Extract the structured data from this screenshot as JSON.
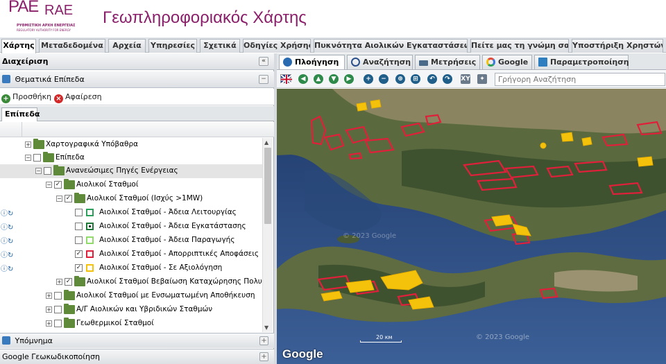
{
  "brand": {
    "logo_main": "PAE",
    "logo_alt": "RAE",
    "logo_sub1": "ΡΥΘΜΙΣΤΙΚΗ ΑΡΧΗ ΕΝΕΡΓΕΙΑΣ",
    "logo_sub2": "REGULATORY AUTHORITY FOR ENERGY",
    "title": "Γεωπληροφοριακός Χάρτης",
    "color": "#8a1f6a"
  },
  "top_tabs": [
    {
      "label": "Χάρτης",
      "active": true
    },
    {
      "label": "Μεταδεδομένα",
      "active": false
    },
    {
      "label": "Αρχεία",
      "active": false
    },
    {
      "label": "Υπηρεσίες",
      "active": false
    },
    {
      "label": "Σχετικά",
      "active": false
    },
    {
      "label": "Οδηγίες Χρήσης",
      "active": false
    },
    {
      "label": "Πυκνότητα Αιολικών Εγκαταστάσεων",
      "active": false
    },
    {
      "label": "Πείτε μας τη γνώμη σας",
      "active": false
    },
    {
      "label": "Υποστήριξη Χρηστών",
      "active": false
    }
  ],
  "left_panel": {
    "title": "Διαχείριση",
    "collapse_icon": "double-chevron-left-icon",
    "thematic_title": "Θεματικά Επίπεδα",
    "add_label": "Προσθήκη",
    "remove_label": "Αφαίρεση",
    "inner_tab": "Επίπεδα",
    "legend_title": "Υπόμνημα",
    "geocode_title": "Google Γεωκωδικοποίηση"
  },
  "tree": [
    {
      "label": "Χαρτογραφικά Υπόβαθρα",
      "checked": false,
      "expander": "+",
      "legend": null
    },
    {
      "label": "Επίπεδα",
      "checked": false,
      "expander": "−",
      "legend": null
    },
    {
      "label": "Ανανεώσιμες Πηγές Ενέργειας",
      "checked": false,
      "expander": "−",
      "legend": null,
      "highlight": true
    },
    {
      "label": "Αιολικοί Σταθμοί",
      "checked": true,
      "expander": "−",
      "legend": null
    },
    {
      "label": "Αιολικοί Σταθμοί (Ισχύς >1MW)",
      "checked": true,
      "expander": "−",
      "legend": null
    },
    {
      "label": "Αιολικοί Σταθμοί - Άδεια Λειτουργίας",
      "checked": false,
      "expander": null,
      "legend": "#2aa05a",
      "info": true
    },
    {
      "label": "Αιολικοί Σταθμοί - Άδεια Εγκατάστασης",
      "checked": false,
      "expander": null,
      "legend": "#1f7a3a",
      "info": true
    },
    {
      "label": "Αιολικοί Σταθμοί - Άδεια Παραγωγής",
      "checked": false,
      "expander": null,
      "legend": "#8fdc6a",
      "info": true
    },
    {
      "label": "Αιολικοί Σταθμοί - Απορριπτικές Αποφάσεις",
      "checked": true,
      "expander": null,
      "legend": "#e0203a",
      "info": true
    },
    {
      "label": "Αιολικοί Σταθμοί - Σε Αξιολόγηση",
      "checked": true,
      "expander": null,
      "legend": "#f4c20a",
      "info": true
    },
    {
      "label": "Αιολικοί Σταθμοί Βεβαίωση Καταχώρησης Πολυγώνου",
      "checked": true,
      "expander": "+",
      "legend": null
    },
    {
      "label": "Αιολικοί Σταθμοί με Ενσωματωμένη Αποθήκευση",
      "checked": false,
      "expander": "+",
      "legend": null
    },
    {
      "label": "Α/Γ Αιολικών και Υβριδικών Σταθμών",
      "checked": false,
      "expander": "+",
      "legend": null
    },
    {
      "label": "Γεωθερμικοί Σταθμοί",
      "checked": false,
      "expander": "+",
      "legend": null
    }
  ],
  "map_tabs": [
    {
      "label": "Πλοήγηση",
      "active": true,
      "icon": "navigation-icon"
    },
    {
      "label": "Αναζήτηση",
      "active": false,
      "icon": "magnifier-icon"
    },
    {
      "label": "Μετρήσεις",
      "active": false,
      "icon": "ruler-icon"
    },
    {
      "label": "Google",
      "active": false,
      "icon": "google-icon"
    },
    {
      "label": "Παραμετροποίηση",
      "active": false,
      "icon": "settings-icon"
    }
  ],
  "map": {
    "search_placeholder": "Γρήγορη Αναζήτηση",
    "scale_label": "20 км",
    "copyright": "© 2023 Google",
    "watermark": "© 2023 Google",
    "google_logo": "Google"
  }
}
